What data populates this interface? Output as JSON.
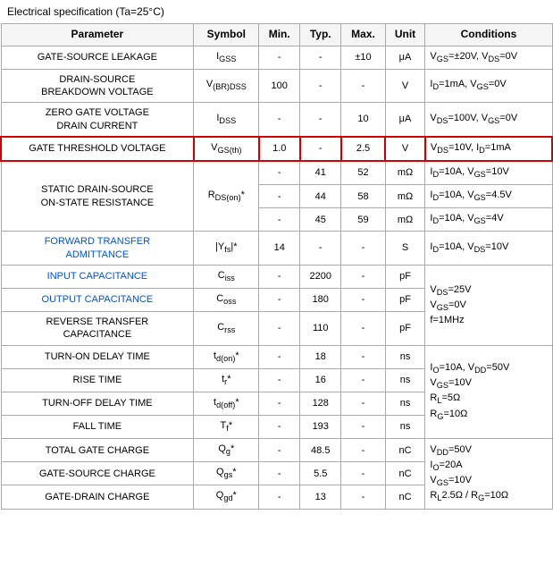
{
  "header": {
    "title": "Electrical specification (Ta=25°C)"
  },
  "table": {
    "columns": [
      "Parameter",
      "Symbol",
      "Min.",
      "Typ.",
      "Max.",
      "Unit",
      "Conditions"
    ],
    "rows": [
      {
        "param": "GATE-SOURCE LEAKAGE",
        "symbol": "IGSS",
        "min": "-",
        "typ": "-",
        "max": "±10",
        "unit": "μA",
        "conditions": "VGS=±20V, VDS=0V",
        "highlight": false,
        "blue": false,
        "rowspan_param": 1,
        "rowspan_cond": 1
      },
      {
        "param": "DRAIN-SOURCE BREAKDOWN VOLTAGE",
        "symbol": "V(BR)DSS",
        "min": "100",
        "typ": "-",
        "max": "-",
        "unit": "V",
        "conditions": "ID=1mA, VGS=0V",
        "highlight": false,
        "blue": false,
        "rowspan_param": 1,
        "rowspan_cond": 1
      },
      {
        "param": "ZERO GATE VOLTAGE DRAIN CURRENT",
        "symbol": "IDSS",
        "min": "-",
        "typ": "-",
        "max": "10",
        "unit": "μA",
        "conditions": "VDS=100V, VGS=0V",
        "highlight": false,
        "blue": false,
        "rowspan_param": 1,
        "rowspan_cond": 1
      },
      {
        "param": "GATE THRESHOLD VOLTAGE",
        "symbol": "VGS(th)",
        "min": "1.0",
        "typ": "-",
        "max": "2.5",
        "unit": "V",
        "conditions": "VDS=10V, ID=1mA",
        "highlight": true,
        "blue": false,
        "rowspan_param": 1,
        "rowspan_cond": 1
      },
      {
        "param": "STATIC DRAIN-SOURCE ON-STATE RESISTANCE",
        "symbol": "RDS(on)*",
        "rows": [
          {
            "min": "-",
            "typ": "41",
            "max": "52",
            "unit": "mΩ",
            "conditions": "ID=10A, VGS=10V"
          },
          {
            "min": "-",
            "typ": "44",
            "max": "58",
            "unit": "mΩ",
            "conditions": "ID=10A, VGS=4.5V"
          },
          {
            "min": "-",
            "typ": "45",
            "max": "59",
            "unit": "mΩ",
            "conditions": "ID=10A, VGS=4V"
          }
        ],
        "multi": true,
        "highlight": false,
        "blue": false
      },
      {
        "param": "FORWARD TRANSFER ADMITTANCE",
        "symbol": "|Yfs|*",
        "min": "14",
        "typ": "-",
        "max": "-",
        "unit": "S",
        "conditions": "ID=10A, VDS=10V",
        "highlight": false,
        "blue": true,
        "rowspan_param": 1,
        "rowspan_cond": 1
      },
      {
        "param": "INPUT CAPACITANCE",
        "symbol": "Ciss",
        "min": "-",
        "typ": "2200",
        "max": "-",
        "unit": "pF",
        "conditions": "",
        "highlight": false,
        "blue": true,
        "rowspan_param": 1,
        "rowspan_cond": 3,
        "cond_shared": "VDS=25V\nVGS=0V\nf=1MHz"
      },
      {
        "param": "OUTPUT CAPACITANCE",
        "symbol": "Coss",
        "min": "-",
        "typ": "180",
        "max": "-",
        "unit": "pF",
        "conditions": "",
        "highlight": false,
        "blue": true,
        "rowspan_param": 1,
        "rowspan_cond": 0
      },
      {
        "param": "REVERSE TRANSFER CAPACITANCE",
        "symbol": "Crss",
        "min": "-",
        "typ": "110",
        "max": "-",
        "unit": "pF",
        "conditions": "",
        "highlight": false,
        "blue": false,
        "rowspan_param": 1,
        "rowspan_cond": 0
      },
      {
        "param": "TURN-ON DELAY TIME",
        "symbol": "td(on)*",
        "min": "-",
        "typ": "18",
        "max": "-",
        "unit": "ns",
        "conditions": "",
        "highlight": false,
        "blue": false,
        "rowspan_param": 1,
        "rowspan_cond": 4,
        "cond_shared": "IO=10A, VDD=50V\nVGS=10V\nRL=5Ω\nRG=10Ω"
      },
      {
        "param": "RISE TIME",
        "symbol": "tr*",
        "min": "-",
        "typ": "16",
        "max": "-",
        "unit": "ns",
        "conditions": "",
        "highlight": false,
        "blue": false,
        "rowspan_cond": 0
      },
      {
        "param": "TURN-OFF DELAY TIME",
        "symbol": "td(off)*",
        "min": "-",
        "typ": "128",
        "max": "-",
        "unit": "ns",
        "conditions": "",
        "highlight": false,
        "blue": false,
        "rowspan_cond": 0
      },
      {
        "param": "FALL TIME",
        "symbol": "Tf*",
        "min": "-",
        "typ": "193",
        "max": "-",
        "unit": "ns",
        "conditions": "",
        "highlight": false,
        "blue": false,
        "rowspan_cond": 0
      },
      {
        "param": "TOTAL GATE CHARGE",
        "symbol": "Qg*",
        "min": "-",
        "typ": "48.5",
        "max": "-",
        "unit": "nC",
        "conditions": "",
        "highlight": false,
        "blue": false,
        "rowspan_param": 1,
        "rowspan_cond": 3,
        "cond_shared": "VDD=50V\nIO=20A\nVGS=10V\nRL2.5Ω / RG=10Ω"
      },
      {
        "param": "GATE-SOURCE CHARGE",
        "symbol": "Qgs*",
        "min": "-",
        "typ": "5.5",
        "max": "-",
        "unit": "nC",
        "conditions": "",
        "highlight": false,
        "blue": false,
        "rowspan_cond": 0
      },
      {
        "param": "GATE-DRAIN CHARGE",
        "symbol": "Qgd*",
        "min": "-",
        "typ": "13",
        "max": "-",
        "unit": "nC",
        "conditions": "",
        "highlight": false,
        "blue": false,
        "rowspan_cond": 0
      }
    ]
  }
}
